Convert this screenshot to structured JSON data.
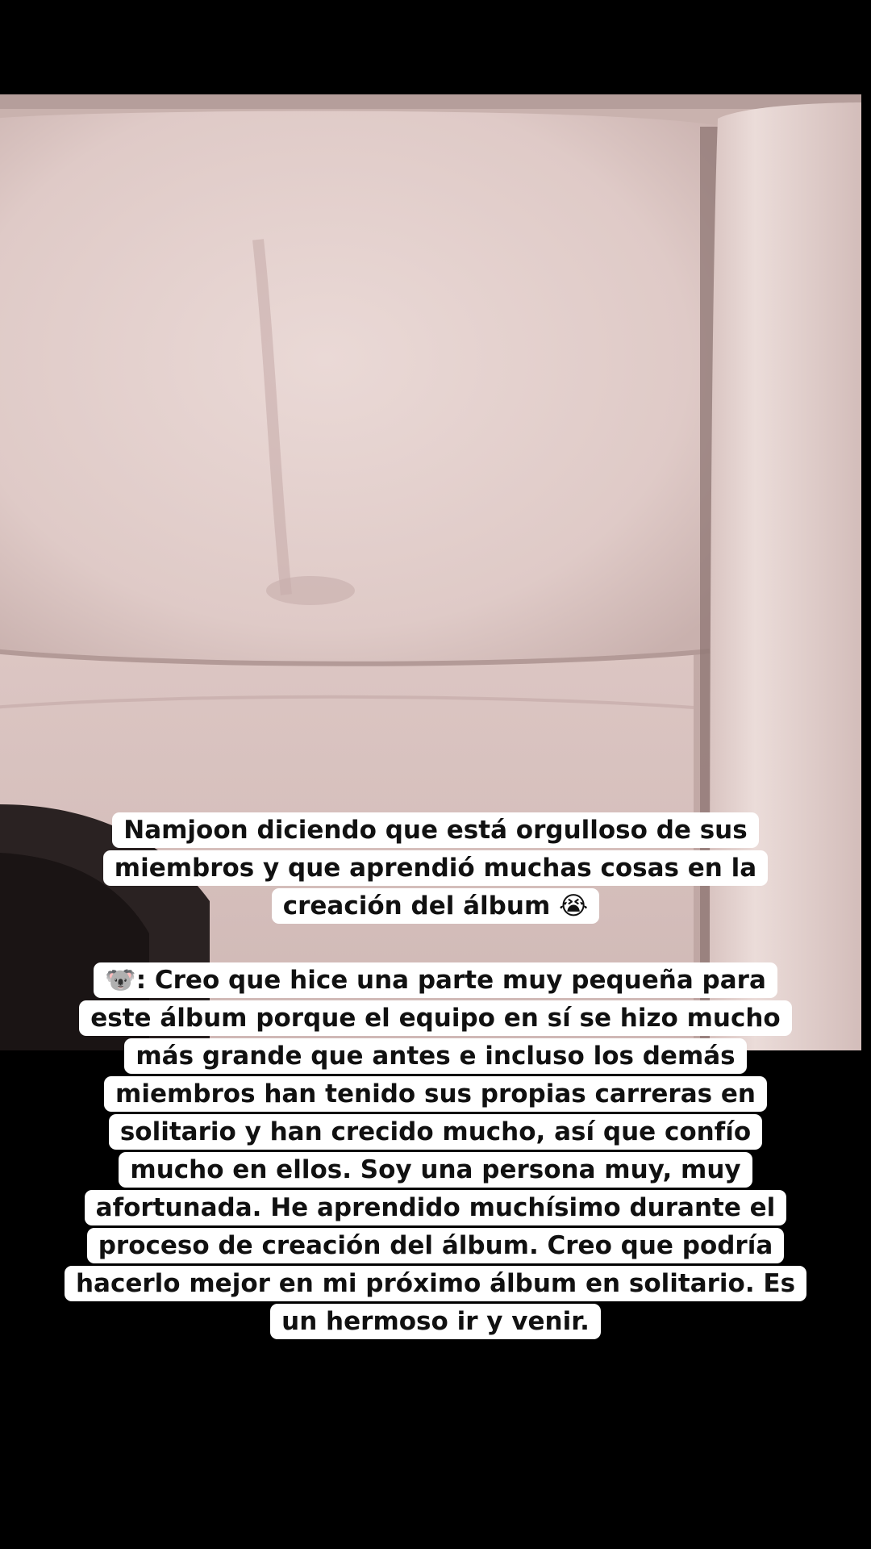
{
  "photo": {
    "subject": "pink-cushion-photo",
    "colors": {
      "upholstery_light": "#e8d6d3",
      "upholstery_mid": "#d6c1be",
      "upholstery_shadow": "#a88f8d",
      "background_dark": "#1a1414"
    }
  },
  "caption": {
    "title_lines": [
      "Namjoon diciendo que está orgulloso de sus",
      "miembros y que aprendió muchas cosas en la",
      "creación del álbum 😭"
    ],
    "quote_lines": [
      "🐨: Creo que hice una parte muy pequeña para",
      "este álbum porque el equipo en sí se hizo mucho",
      "más grande que antes e incluso los demás",
      "miembros han tenido sus propias carreras en",
      "solitario y han crecido mucho, así que confío",
      "mucho en ellos. Soy una persona muy, muy",
      "afortunada. He aprendido muchísimo durante el",
      "proceso de creación del álbum. Creo que podría",
      "hacerlo mejor en mi próximo álbum en solitario. Es",
      "un hermoso ir y venir."
    ],
    "colors": {
      "text": "#111111",
      "highlight": "#ffffff"
    }
  }
}
